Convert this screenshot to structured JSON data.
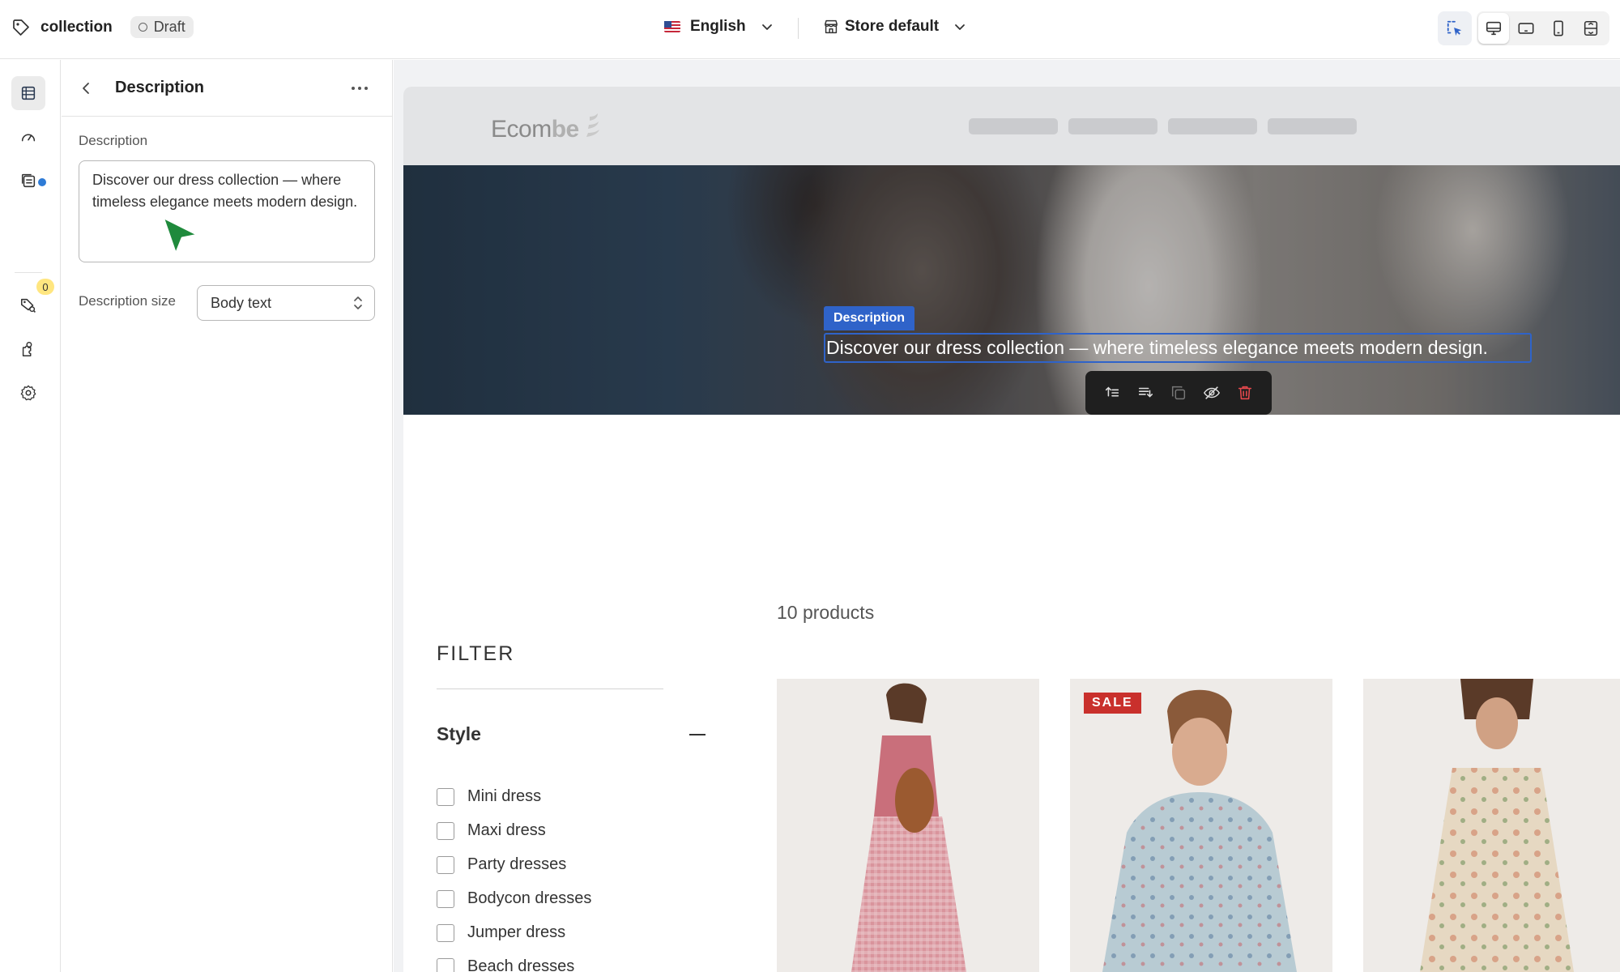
{
  "topbar": {
    "page_name": "collection",
    "status": "Draft",
    "language": "English",
    "store": "Store default"
  },
  "panel": {
    "title": "Description",
    "description_label": "Description",
    "description_value": "Discover our dress collection — where timeless elegance meets modern design.",
    "size_label": "Description size",
    "size_value": "Body text"
  },
  "rail": {
    "badge_count": "0"
  },
  "preview": {
    "logo_text": "Ecom",
    "logo_bold": "be",
    "selection_label": "Description",
    "hero_text": "Discover our dress collection — where timeless elegance meets modern design.",
    "product_count": "10 products",
    "filter_title": "FILTER",
    "style_heading": "Style",
    "style_options": [
      "Mini dress",
      "Maxi dress",
      "Party dresses",
      "Bodycon dresses",
      "Jumper dress",
      "Beach dresses"
    ],
    "sale_badge": "SALE"
  },
  "colors": {
    "accent": "#2f63c9",
    "sale": "#c9302c",
    "cursor": "#1f8a3c"
  }
}
